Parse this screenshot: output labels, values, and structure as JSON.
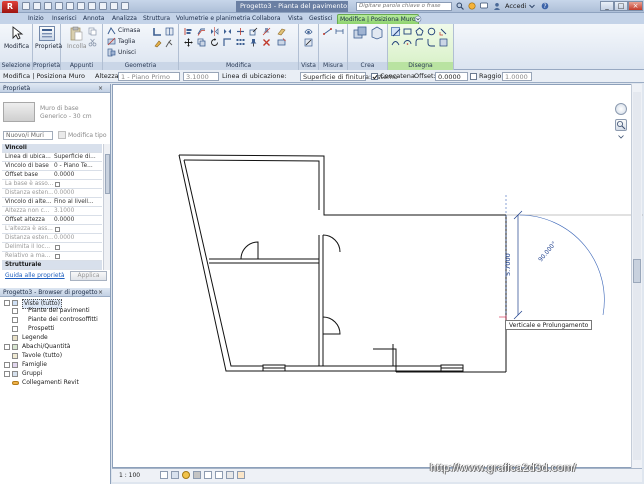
{
  "app": {
    "doc_title": "Progetto3 - Pianta del pavimento: ...",
    "search_placeholder": "Digitare parola chiave o frase",
    "user": "Accedi",
    "app_button": "R"
  },
  "tabs": [
    "Inizio",
    "Inserisci",
    "Annota",
    "Analizza",
    "Struttura",
    "Volumetrie e planimetria",
    "Collabora",
    "Vista",
    "Gestisci",
    "Modifica | Posiziona Muro"
  ],
  "ribbon": {
    "modify_label": "Modifica",
    "properties_label": "Proprietà",
    "paste_label": "Incolla",
    "cope_label": "Cimasa",
    "cut_label": "Taglia",
    "join_label": "Unisci",
    "panels": [
      "Selezione",
      "Proprietà",
      "Appunti",
      "Geometria",
      "Modifica",
      "Vista",
      "Misura",
      "Crea",
      "Disegna"
    ]
  },
  "options_bar": {
    "mode": "Modifica | Posiziona Muro",
    "height_label": "Altezza:",
    "height_value": "1 - Piano Primo",
    "height_num": "3.1000",
    "loc_label": "Linea di ubicazione:",
    "loc_value": "Superficie di finitura: esterno",
    "chain_label": "Concatena",
    "offset_label": "Offset:",
    "offset_value": "0.0000",
    "radius_label": "Raggio:",
    "radius_value": "1.0000"
  },
  "properties": {
    "title": "Proprietà",
    "type_name": "Muro di base",
    "type_sub": "Generico - 30 cm",
    "selector": "Nuovo/i Muri",
    "edit_type": "Modifica tipo",
    "section": "Vincoli",
    "rows": [
      {
        "k": "Linea di ubica...",
        "v": "Superficie di..."
      },
      {
        "k": "Vincolo di base",
        "v": "0 - Piano Te..."
      },
      {
        "k": "Offset base",
        "v": "0.0000"
      },
      {
        "k": "La base è asso...",
        "v": ""
      },
      {
        "k": "Distanza esten...",
        "v": "0.0000"
      },
      {
        "k": "Vincolo di alte...",
        "v": "Fino al livell..."
      },
      {
        "k": "Altezza non c...",
        "v": "3.1000"
      },
      {
        "k": "Offset altezza",
        "v": "0.0000"
      },
      {
        "k": "L'altezza è ass...",
        "v": ""
      },
      {
        "k": "Distanza esten...",
        "v": "0.0000"
      },
      {
        "k": "Delimita il loc...",
        "v": ""
      },
      {
        "k": "Relativo a ma...",
        "v": ""
      }
    ],
    "section2": "Strutturale",
    "help_link": "Guida alle proprietà",
    "apply": "Applica"
  },
  "browser": {
    "title": "Progetto3 - Browser di progetto",
    "items": [
      {
        "label": "Viste (tutto)",
        "level": 0
      },
      {
        "label": "Piante dei pavimenti",
        "level": 1
      },
      {
        "label": "Piante dei controsoffitti",
        "level": 1
      },
      {
        "label": "Prospetti",
        "level": 1
      },
      {
        "label": "Legende",
        "level": 0
      },
      {
        "label": "Abachi/Quantità",
        "level": 0
      },
      {
        "label": "Tavole (tutto)",
        "level": 0
      },
      {
        "label": "Famiglie",
        "level": 0
      },
      {
        "label": "Gruppi",
        "level": 0
      },
      {
        "label": "Collegamenti Revit",
        "level": 0
      }
    ]
  },
  "canvas": {
    "dim_text": "5.7000",
    "angle_text": "90.000°",
    "tooltip": "Verticale e Prolungamento",
    "scale": "1 : 100"
  },
  "watermark": "http://www.grafica2d3d.com/"
}
